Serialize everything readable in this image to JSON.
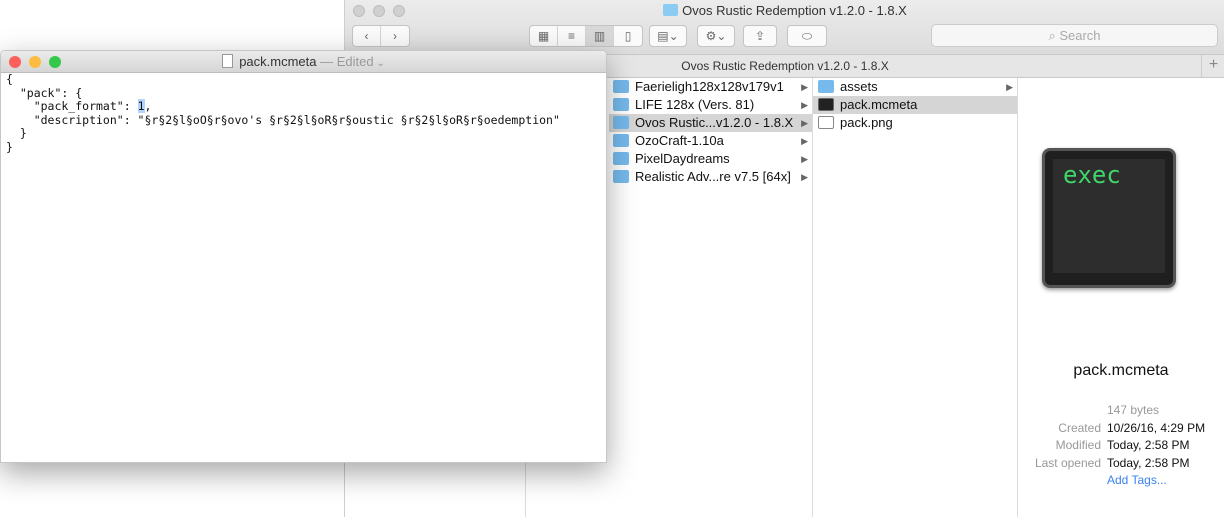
{
  "finder": {
    "title": "Ovos Rustic Redemption v1.2.0 - 1.8.X",
    "path_title": "Ovos Rustic Redemption v1.2.0 - 1.8.X",
    "search_placeholder": "Search",
    "folders": [
      {
        "name": "Faerieligh128x128v179v1"
      },
      {
        "name": "LIFE 128x (Vers. 81)"
      },
      {
        "name": "Ovos Rustic...v1.2.0 - 1.8.X"
      },
      {
        "name": "OzoCraft-1.10a"
      },
      {
        "name": "PixelDaydreams"
      },
      {
        "name": "Realistic Adv...re v7.5 [64x]"
      }
    ],
    "contents": [
      {
        "name": "assets"
      },
      {
        "name": "pack.mcmeta"
      },
      {
        "name": "pack.png"
      }
    ],
    "preview": {
      "icon_text": "exec",
      "name": "pack.mcmeta",
      "size": "147 bytes",
      "created_label": "Created",
      "created": "10/26/16, 4:29 PM",
      "modified_label": "Modified",
      "modified": "Today, 2:58 PM",
      "opened_label": "Last opened",
      "opened": "Today, 2:58 PM",
      "add_tags": "Add Tags..."
    }
  },
  "textedit": {
    "title": "pack.mcmeta",
    "status": "— Edited",
    "lines": [
      "{",
      "  \"pack\": {",
      "    \"pack_format\": ",
      "    \"description\": \"§r§2§l§oO§r§ovo's §r§2§l§oR§r§oustic §r§2§l§oR§r§oedemption\"",
      "  }",
      "}"
    ],
    "selected_value": "1",
    "comma": ","
  }
}
